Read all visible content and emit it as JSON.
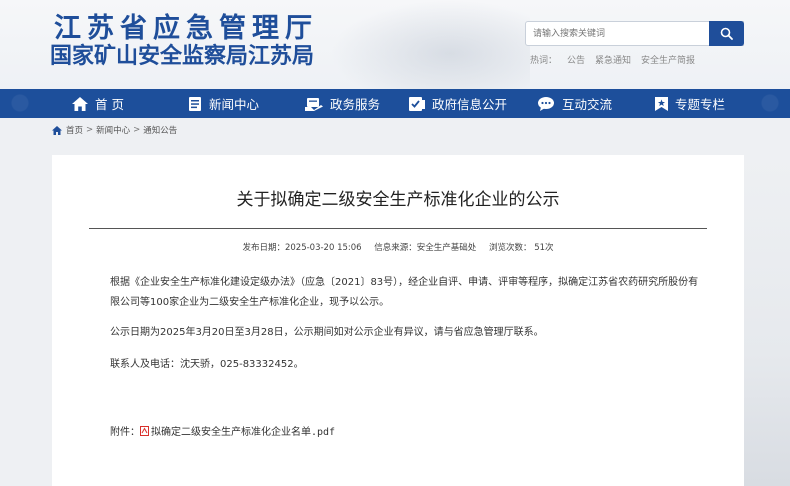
{
  "header": {
    "logo_line1": "江苏省应急管理厅",
    "logo_line2": "国家矿山安全监察局江苏局",
    "search_placeholder": "请输入搜索关键词",
    "hot_label": "热词：",
    "hot_words": [
      "公告",
      "紧急通知",
      "安全生产简报"
    ]
  },
  "nav": {
    "items": [
      {
        "label": "首 页",
        "icon": "home-icon"
      },
      {
        "label": "新闻中心",
        "icon": "news-icon"
      },
      {
        "label": "政务服务",
        "icon": "service-icon"
      },
      {
        "label": "政府信息公开",
        "icon": "info-icon"
      },
      {
        "label": "互动交流",
        "icon": "chat-icon"
      },
      {
        "label": "专题专栏",
        "icon": "bookmark-icon"
      }
    ]
  },
  "breadcrumb": {
    "home": "首页",
    "sep": ">",
    "level1": "新闻中心",
    "level2": "通知公告"
  },
  "article": {
    "title": "关于拟确定二级安全生产标准化企业的公示",
    "publish_date": "发布日期：2025-03-20 15:06",
    "source": "信息来源：安全生产基础处",
    "views": "浏览次数： 51次",
    "para1_line1": "根据《企业安全生产标准化建设定级办法》（应急〔2021〕83号），经企业自评、申请、评审等程序，拟确定江苏省农药研究所股份有",
    "para1_line2": "限公司等100家企业为二级安全生产标准化企业，现予以公示。",
    "para2": "公示日期为2025年3月20日至3月28日，公示期间如对公示企业有异议，请与省应急管理厅联系。",
    "para3": "联系人及电话：沈天骄，025-83332452。",
    "attach_label": "附件：",
    "attach_file": "拟确定二级安全生产标准化企业名单.pdf"
  },
  "colors": {
    "brand_blue": "#1f4e9a",
    "nav_blue": "#1d4f9b",
    "pdf_red": "#d9302c"
  }
}
